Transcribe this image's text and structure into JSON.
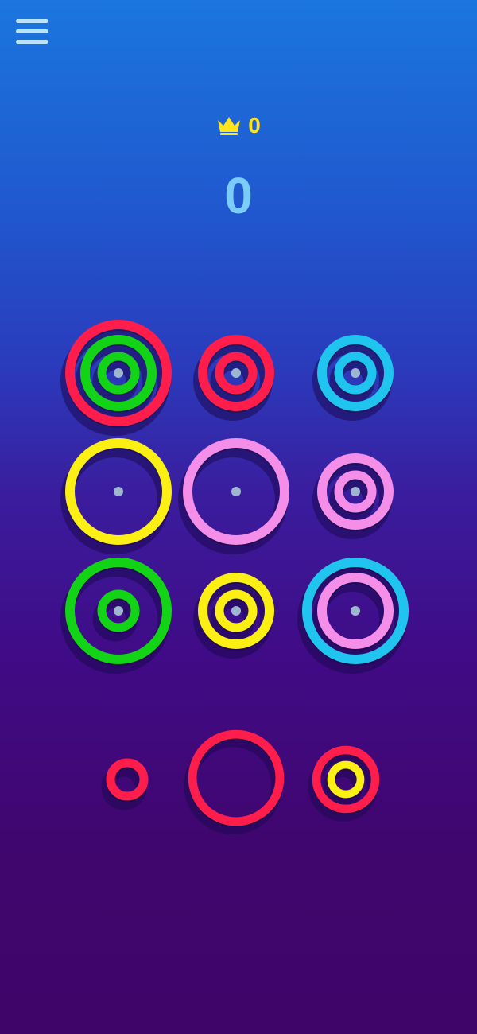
{
  "colors": {
    "red": "#ff1e4b",
    "green": "#13d316",
    "cyan": "#1fc5ee",
    "yellow": "#fbef13",
    "pink": "#f58ee8",
    "peg": "#9fb6d0",
    "shadow": "#1c0a52"
  },
  "hud": {
    "menu_icon": "hamburger-menu-icon",
    "best_icon": "crown-icon",
    "best_score": "0",
    "current_score": "0"
  },
  "board": {
    "rows": 3,
    "columns": 3,
    "cells": [
      {
        "name": "slot-r1c1",
        "rings": [
          {
            "size": "large",
            "color": "red"
          },
          {
            "size": "medium",
            "color": "green"
          },
          {
            "size": "small",
            "color": "green"
          }
        ]
      },
      {
        "name": "slot-r1c2",
        "rings": [
          {
            "size": "medium",
            "color": "red"
          },
          {
            "size": "small",
            "color": "red"
          }
        ]
      },
      {
        "name": "slot-r1c3",
        "rings": [
          {
            "size": "medium",
            "color": "cyan"
          },
          {
            "size": "small",
            "color": "cyan"
          }
        ]
      },
      {
        "name": "slot-r2c1",
        "rings": [
          {
            "size": "large",
            "color": "yellow"
          }
        ]
      },
      {
        "name": "slot-r2c2",
        "rings": [
          {
            "size": "large",
            "color": "pink"
          }
        ]
      },
      {
        "name": "slot-r2c3",
        "rings": [
          {
            "size": "medium",
            "color": "pink"
          },
          {
            "size": "small",
            "color": "pink"
          }
        ]
      },
      {
        "name": "slot-r3c1",
        "rings": [
          {
            "size": "large",
            "color": "green"
          },
          {
            "size": "small",
            "color": "green"
          }
        ]
      },
      {
        "name": "slot-r3c2",
        "rings": [
          {
            "size": "medium",
            "color": "yellow"
          },
          {
            "size": "small",
            "color": "yellow"
          }
        ]
      },
      {
        "name": "slot-r3c3",
        "rings": [
          {
            "size": "large",
            "color": "cyan"
          },
          {
            "size": "medium",
            "color": "pink"
          }
        ]
      }
    ]
  },
  "tray": {
    "pieces": [
      {
        "name": "tray-piece-left",
        "rings": [
          {
            "size": "small",
            "color": "red"
          }
        ]
      },
      {
        "name": "tray-piece-center",
        "rings": [
          {
            "size": "large",
            "color": "red"
          }
        ]
      },
      {
        "name": "tray-piece-right",
        "rings": [
          {
            "size": "medium",
            "color": "red"
          },
          {
            "size": "small",
            "color": "yellow"
          }
        ]
      }
    ]
  }
}
